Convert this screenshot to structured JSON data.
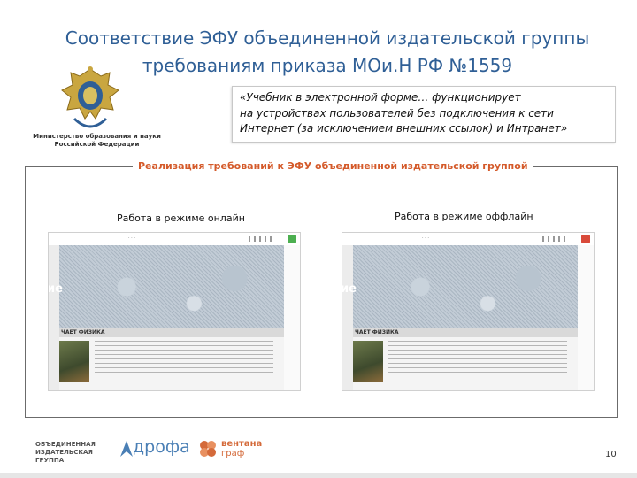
{
  "slide": {
    "title_line1": "Соответствие ЭФУ объединенной издательской группы",
    "title_line2": "требованиям приказа МОи.Н РФ №1559"
  },
  "ministry": {
    "line1": "Министерство образования и науки",
    "line2": "Российской Федерации"
  },
  "quote": {
    "line1": "«Учебник в электронной форме… функционирует",
    "line2": "на устройствах пользователей без подключения к сети",
    "line3": "Интернет (за исключением внешних ссылок) и Интранет»"
  },
  "frame": {
    "caption": "Реализация требований к ЭФУ объединенной издательской группой"
  },
  "modes": {
    "online": "Работа в режиме онлайн",
    "offline": "Работа в режиме оффлайн"
  },
  "screens": {
    "online": {
      "status_color": "#4caf50",
      "section": "ЧАЕТ ФИЗИКА",
      "overlay": "ие"
    },
    "offline": {
      "status_color": "#d94a3a",
      "section": "ЧАЕТ ФИЗИКА",
      "overlay": "ие"
    }
  },
  "footer": {
    "group_line1": "ОБЪЕДИНЕННАЯ",
    "group_line2": "ИЗДАТЕЛЬСКАЯ ГРУППА",
    "drofa": "дрофа",
    "ventana_line1": "вентана",
    "ventana_line2": "граф",
    "page": "10"
  },
  "colors": {
    "title": "#2f5f96",
    "caption": "#d45a2a",
    "drofa": "#4a7fb5",
    "ventana": "#d46a3a"
  }
}
